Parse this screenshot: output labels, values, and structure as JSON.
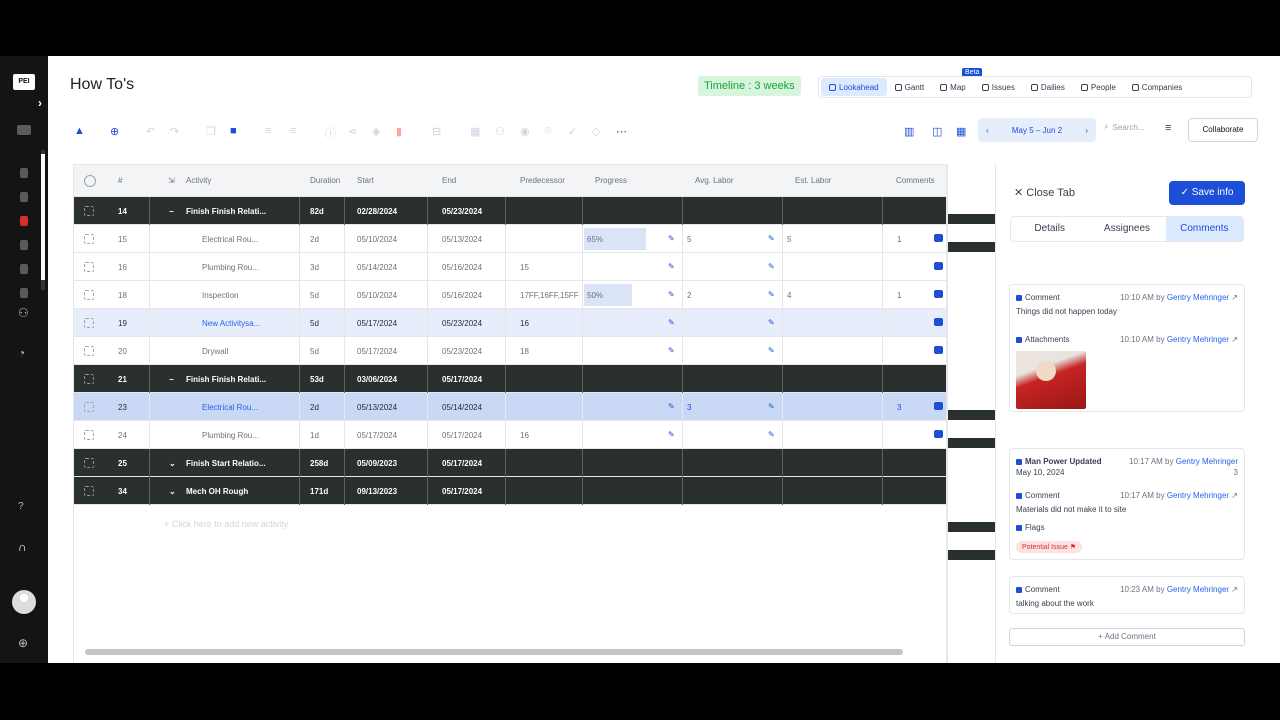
{
  "app": {
    "logo": "PEI",
    "title": "How To's",
    "timeline_badge": "Timeline : 3 weeks"
  },
  "views": [
    {
      "label": "Lookahead",
      "icon": "lookahead-icon",
      "active": true
    },
    {
      "label": "Gantt",
      "icon": "gantt-icon"
    },
    {
      "label": "Map",
      "icon": "map-icon",
      "badge": "Beta"
    },
    {
      "label": "Issues",
      "icon": "issues-icon"
    },
    {
      "label": "Dailies",
      "icon": "dailies-icon"
    },
    {
      "label": "People",
      "icon": "people-icon"
    },
    {
      "label": "Companies",
      "icon": "companies-icon"
    }
  ],
  "toolbar": {
    "date_range": "May 5 – Jun 2",
    "search_placeholder": "Search...",
    "collaborate": "Collaborate"
  },
  "grid": {
    "headers": {
      "num": "#",
      "activity": "Activity",
      "duration": "Duration",
      "start": "Start",
      "end": "End",
      "predecessor": "Predecessor",
      "progress": "Progress",
      "avg_labor": "Avg. Labor",
      "est_labor": "Est. Labor",
      "comments": "Comments"
    },
    "rows": [
      {
        "id": "14",
        "activity": "Finish Finish Relati...",
        "duration": "82d",
        "start": "02/28/2024",
        "end": "05/23/2024",
        "pred": "",
        "progress": "",
        "avg": "",
        "est": "",
        "comments": "",
        "type": "dark",
        "collapse": "−"
      },
      {
        "id": "15",
        "activity": "Electrical Rou...",
        "duration": "2d",
        "start": "05/10/2024",
        "end": "05/13/2024",
        "pred": "",
        "progress": "65%",
        "avg": "5",
        "est": "5",
        "comments": "1",
        "type": "light"
      },
      {
        "id": "16",
        "activity": "Plumbing Rou...",
        "duration": "3d",
        "start": "05/14/2024",
        "end": "05/16/2024",
        "pred": "15",
        "progress": "",
        "avg": "",
        "est": "",
        "comments": "",
        "type": "light"
      },
      {
        "id": "18",
        "activity": "Inspection",
        "duration": "5d",
        "start": "05/10/2024",
        "end": "05/16/2024",
        "pred": "17FF,16FF,15FF",
        "progress": "50%",
        "avg": "2",
        "est": "4",
        "comments": "1",
        "type": "light"
      },
      {
        "id": "19",
        "activity": "New Activitysa...",
        "duration": "5d",
        "start": "05/17/2024",
        "end": "05/23/2024",
        "pred": "16",
        "progress": "",
        "avg": "",
        "est": "",
        "comments": "",
        "type": "sel"
      },
      {
        "id": "20",
        "activity": "Drywall",
        "duration": "5d",
        "start": "05/17/2024",
        "end": "05/23/2024",
        "pred": "18",
        "progress": "",
        "avg": "",
        "est": "",
        "comments": "",
        "type": "light"
      },
      {
        "id": "21",
        "activity": "Finish Finish Relati...",
        "duration": "53d",
        "start": "03/06/2024",
        "end": "05/17/2024",
        "pred": "",
        "progress": "",
        "avg": "",
        "est": "",
        "comments": "",
        "type": "dark",
        "collapse": "−"
      },
      {
        "id": "23",
        "activity": "Electrical Rou...",
        "duration": "2d",
        "start": "05/13/2024",
        "end": "05/14/2024",
        "pred": "",
        "progress": "",
        "avg": "3",
        "est": "",
        "comments": "3",
        "type": "hl"
      },
      {
        "id": "24",
        "activity": "Plumbing Rou...",
        "duration": "1d",
        "start": "05/17/2024",
        "end": "05/17/2024",
        "pred": "16",
        "progress": "",
        "avg": "",
        "est": "",
        "comments": "",
        "type": "light"
      },
      {
        "id": "25",
        "activity": "Finish Start Relatio...",
        "duration": "258d",
        "start": "05/09/2023",
        "end": "05/17/2024",
        "pred": "",
        "progress": "",
        "avg": "",
        "est": "",
        "comments": "",
        "type": "dark",
        "collapse": "⌄"
      },
      {
        "id": "34",
        "activity": "Mech OH Rough",
        "duration": "171d",
        "start": "09/13/2023",
        "end": "05/17/2024",
        "pred": "",
        "progress": "",
        "avg": "",
        "est": "",
        "comments": "",
        "type": "dark",
        "collapse": "⌄"
      }
    ],
    "add_activity": "+ Click here to add new activity"
  },
  "panel": {
    "close_tab": "Close Tab",
    "save_info": "Save info",
    "tabs": [
      "Details",
      "Assignees",
      "Comments"
    ],
    "active_tab": "Comments",
    "card1": {
      "comment_label": "Comment",
      "comment_time": "10:10 AM by",
      "comment_user": "Gentry Mehringer",
      "comment_text": "Things did not happen today",
      "attach_label": "Attachments",
      "attach_time": "10:10 AM by",
      "attach_user": "Gentry Mehringer"
    },
    "card2": {
      "mp_label": "Man Power Updated",
      "mp_time": "10:17 AM by",
      "mp_user": "Gentry Mehringer",
      "mp_date": "May 10, 2024",
      "mp_value": "3",
      "comment_label": "Comment",
      "comment_time": "10:17 AM by",
      "comment_user": "Gentry Mehringer",
      "comment_text": "Materials did not make it to site",
      "flags_label": "Flags",
      "flag_pill": "Potential Issue"
    },
    "card3": {
      "comment_label": "Comment",
      "comment_time": "10:23 AM by",
      "comment_user": "Gentry Mehringer",
      "comment_text": "talking about the work"
    },
    "add_comment": "+ Add Comment"
  }
}
